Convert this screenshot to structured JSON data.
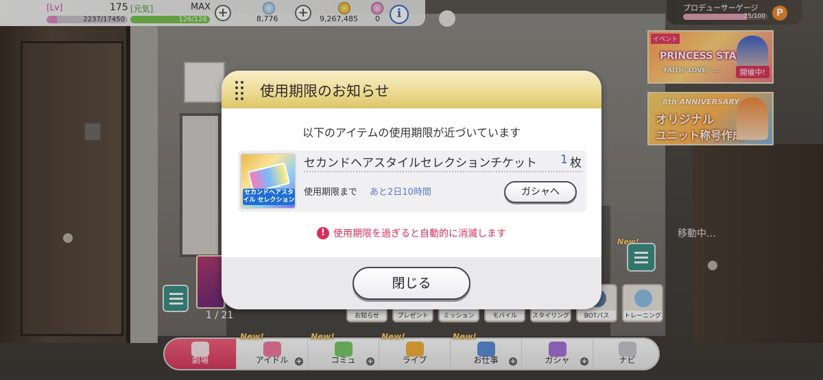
{
  "status": {
    "lv_label": "[Lv]",
    "lv_value": "175",
    "lv_exp": "2237/17450",
    "lv_exp_fraction": 0.128,
    "genki_label": "[元気]",
    "genki_value": "MAX",
    "genki_gauge": "126/126",
    "genki_fraction": 1.0,
    "jewels": "8,776",
    "money": "9,267,485",
    "tickets": "0",
    "info_symbol": "i",
    "plus_symbol": "+"
  },
  "producer_gauge": {
    "label": "プロデューサーゲージ",
    "value": "75/100",
    "fraction": 0.75,
    "icon_letter": "P"
  },
  "banners": [
    {
      "tag": "イベント",
      "title": "PRINCESS STARS",
      "subtitle": "FAITH/ LOVE / ...",
      "status": "開催中!"
    },
    {
      "top": "8th ANNIVERSARY",
      "line1": "オリジナル",
      "line2": "ユニット称号作成!"
    }
  ],
  "scene": {
    "moving_text": "移動中…",
    "page_indicator": "1 / 21",
    "new_badge": "New!"
  },
  "shortcuts": [
    {
      "label": "お知らせ"
    },
    {
      "label": "プレゼント"
    },
    {
      "label": "ミッション"
    },
    {
      "label": "モバイル"
    },
    {
      "label": "スタイリング"
    },
    {
      "label": "BOTパス"
    },
    {
      "label": "トレーニング"
    }
  ],
  "nav": [
    {
      "label": "劇場"
    },
    {
      "label": "アイドル"
    },
    {
      "label": "コミュ"
    },
    {
      "label": "ライブ"
    },
    {
      "label": "お仕事"
    },
    {
      "label": "ガシャ"
    },
    {
      "label": "ナビ"
    }
  ],
  "modal": {
    "title": "使用期限のお知らせ",
    "lead": "以下のアイテムの使用期限が近づいています",
    "item_name": "セカンドヘアスタイルセレクションチケット",
    "item_count": "1",
    "item_unit": "枚",
    "thumb_text": "セカンドヘアスタイル セレクション",
    "expire_label": "使用期限まで",
    "expire_value": "あと2日10時間",
    "gacha_button": "ガシャへ",
    "warning": "使用期限を過ぎると自動的に消滅します",
    "warning_icon": "!",
    "close_button": "閉じる"
  }
}
